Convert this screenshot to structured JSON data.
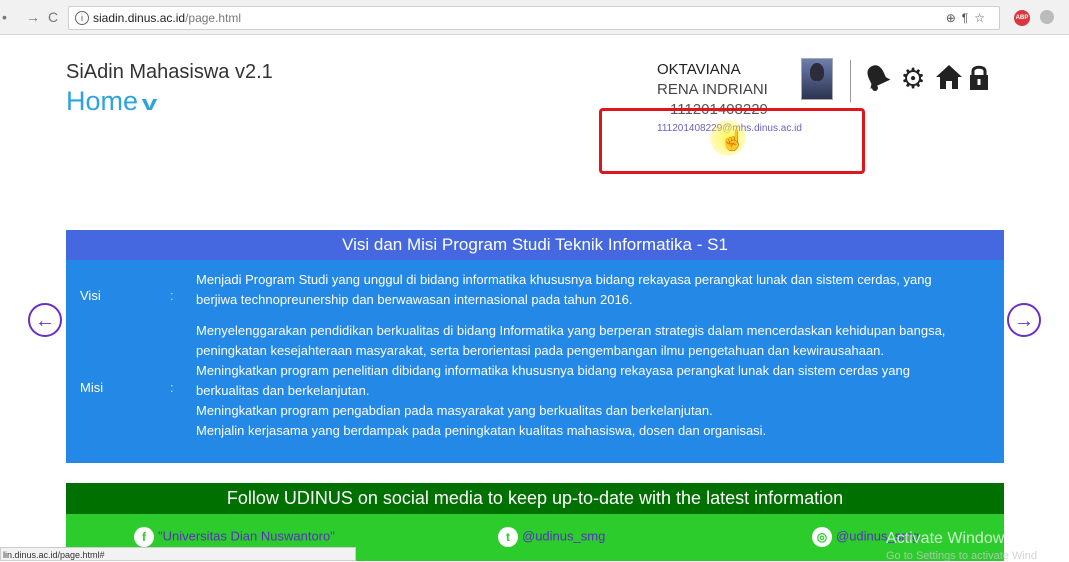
{
  "browser": {
    "url_host": "siadin.dinus.ac.id",
    "url_path": "/page.html",
    "status_url": "lin.dinus.ac.id/page.html#"
  },
  "header": {
    "app_title": "SiAdin Mahasiswa v2.1",
    "page_title": "Home",
    "user": {
      "first_name": "OKTAVIANA",
      "last_name": "RENA INDRIANI",
      "nim": "111201408229",
      "email": "111201408229@mhs.dinus.ac.id"
    },
    "icons": [
      "bell-icon",
      "gear-icon",
      "home-icon",
      "lock-icon"
    ]
  },
  "visi_misi": {
    "title": "Visi dan Misi Program Studi Teknik Informatika - S1",
    "visi_label": "Visi",
    "misi_label": "Misi",
    "colon": ":",
    "visi_text": "Menjadi Program Studi yang unggul di bidang informatika khususnya bidang rekayasa perangkat lunak dan sistem cerdas, yang berjiwa technopreunership dan berwawasan internasional pada tahun 2016.",
    "misi_items": [
      "Menyelenggarakan pendidikan berkualitas di bidang Informatika yang berperan strategis dalam mencerdaskan kehidupan bangsa, peningkatan kesejahteraan masyarakat, serta berorientasi pada pengembangan ilmu pengetahuan dan kewirausahaan.",
      "Meningkatkan program penelitian dibidang informatika khususnya bidang rekayasa perangkat lunak dan sistem cerdas yang berkualitas dan berkelanjutan.",
      "Meningkatkan program pengabdian pada masyarakat yang berkualitas dan berkelanjutan.",
      "Menjalin kerjasama yang berdampak pada peningkatan kualitas mahasiswa, dosen dan organisasi."
    ]
  },
  "social": {
    "banner": "Follow UDINUS on social media to keep up-to-date with the latest information",
    "facebook": "\"Universitas Dian Nuswantoro\"",
    "twitter": "@udinus_smg",
    "instagram": "@udinus_smg"
  },
  "watermark": {
    "line1": "Activate Windows",
    "line2": "Go to Settings to activate Wind"
  },
  "colors": {
    "accent": "#2ea3de",
    "panel_blue": "#2488e6",
    "panel_head": "#4568e0",
    "social_dark": "#007000",
    "social_light": "#2ccc2c",
    "annotation_red": "#e0141a"
  }
}
